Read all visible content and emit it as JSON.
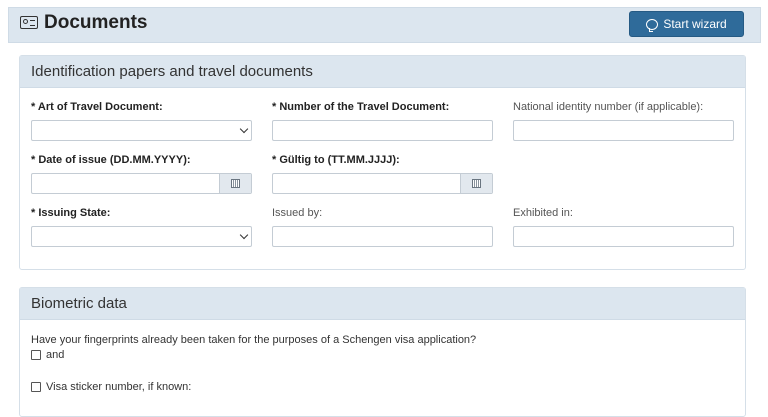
{
  "header": {
    "title": "Documents",
    "icon": "id-card-icon",
    "wizard_label": "Start wizard",
    "wizard_icon": "chat-bubble-icon"
  },
  "travel_docs": {
    "title": "Identification papers and travel documents",
    "art_label": "* Art of Travel Document:",
    "art_value": "",
    "number_label": "* Number of the Travel Document:",
    "number_value": "",
    "national_id_label": "National identity number (if applicable):",
    "national_id_value": "",
    "issue_date_label": "* Date of issue (DD.MM.YYYY):",
    "issue_date_value": "",
    "valid_to_label": "* Gültig to (TT.MM.JJJJ):",
    "valid_to_value": "",
    "issuing_state_label": "* Issuing State:",
    "issuing_state_value": "",
    "issued_by_label": "Issued by:",
    "issued_by_value": "",
    "exhibited_label": "Exhibited in:",
    "exhibited_value": ""
  },
  "biometric": {
    "title": "Biometric data",
    "question": "Have your fingerprints already been taken for the purposes of a Schengen visa application?",
    "checkbox_and": "and",
    "checkbox_and_checked": false,
    "checkbox_visa": "Visa sticker number, if known:",
    "checkbox_visa_checked": false
  },
  "colors": {
    "header_bg": "#dce6ef",
    "accent": "#2f6b9a"
  }
}
